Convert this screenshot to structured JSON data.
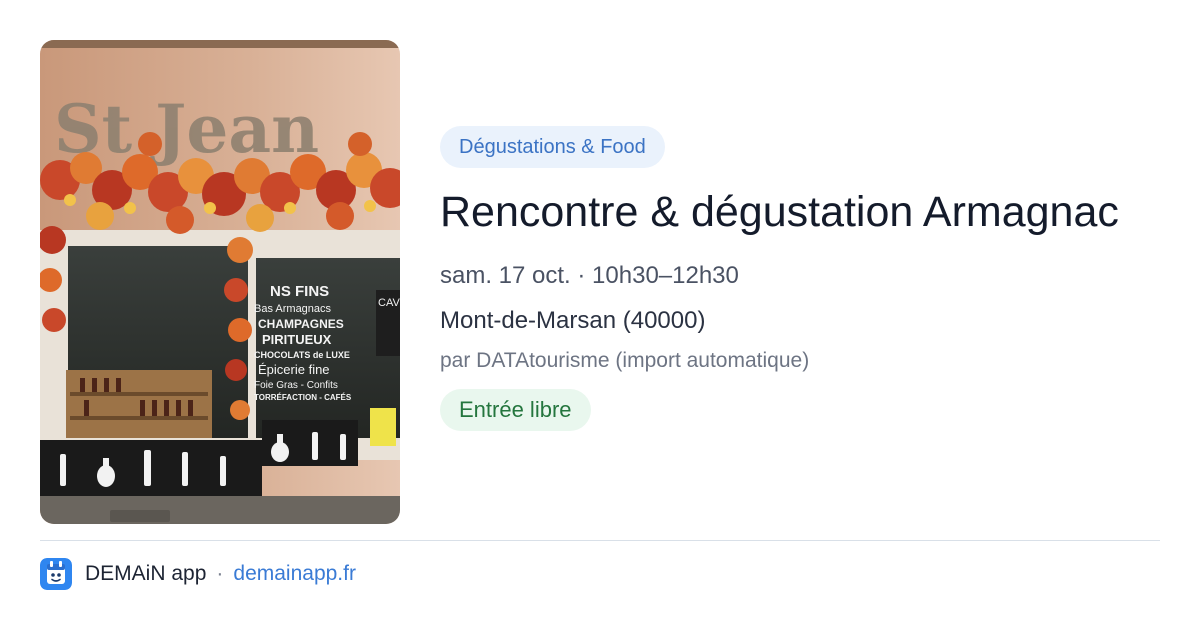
{
  "event": {
    "category": "Dégustations & Food",
    "title": "Rencontre & dégustation Armagnac",
    "datetime": "sam. 17 oct. · 10h30–12h30",
    "location": "Mont-de-Marsan (40000)",
    "source": "par DATAtourisme (import automatique)",
    "price": "Entrée libre"
  },
  "photo": {
    "icon": "shop-front-photo",
    "shop_sign_lines": [
      "NS FINS",
      "Bas Armagnacs",
      "CHAMPAGNES",
      "PIRITUEUX",
      "CHOCOLATS de LUXE",
      "Épicerie fine",
      "Foie Gras - Confits",
      "TORRÉFACTION - CAFÉS"
    ],
    "side_sign": "CAV"
  },
  "footer": {
    "app_name": "DEMAiN app",
    "separator": "·",
    "link": "demainapp.fr"
  },
  "colors": {
    "category_bg": "#eaf2fc",
    "category_text": "#3b73c4",
    "price_bg": "#e9f7ee",
    "price_text": "#24763e",
    "link": "#3a7bd5",
    "logo_bg": "#2f86f0"
  }
}
